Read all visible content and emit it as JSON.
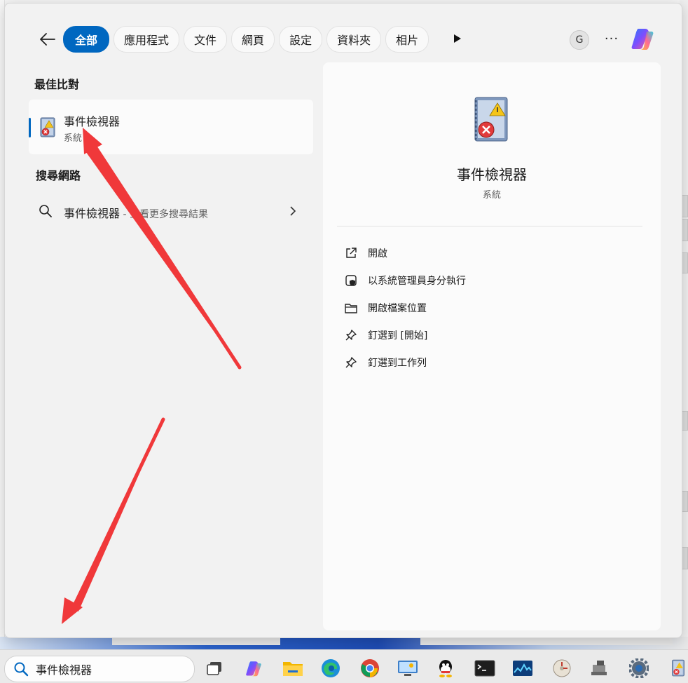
{
  "nav": {
    "chips": [
      "全部",
      "應用程式",
      "文件",
      "網頁",
      "設定",
      "資料夾",
      "相片"
    ],
    "avatar_letter": "G",
    "more_label": "···"
  },
  "best_match": {
    "title": "最佳比對",
    "app_name": "事件檢視器",
    "app_type": "系統"
  },
  "web": {
    "title": "搜尋網路",
    "query": "事件檢視器",
    "hint": " - 查看更多搜尋結果"
  },
  "detail": {
    "app_name": "事件檢視器",
    "app_type": "系統",
    "actions": [
      {
        "icon": "open-external-icon",
        "label": "開啟"
      },
      {
        "icon": "shield-admin-icon",
        "label": "以系統管理員身分執行"
      },
      {
        "icon": "folder-icon",
        "label": "開啟檔案位置"
      },
      {
        "icon": "pin-icon",
        "label": "釘選到 [開始]"
      },
      {
        "icon": "pin-icon",
        "label": "釘選到工作列"
      }
    ]
  },
  "taskbar": {
    "search_value": "事件檢視器",
    "icons": [
      "task-view-icon",
      "copilot-icon",
      "file-explorer-icon",
      "edge-icon",
      "chrome-icon",
      "remote-desktop-icon",
      "qq-icon",
      "terminal-icon",
      "resource-monitor-icon",
      "disk-cleanup-icon",
      "usb-device-icon",
      "settings-icon",
      "event-viewer-icon"
    ]
  },
  "colors": {
    "accent": "#0067c0",
    "arrow": "#f0383a"
  }
}
